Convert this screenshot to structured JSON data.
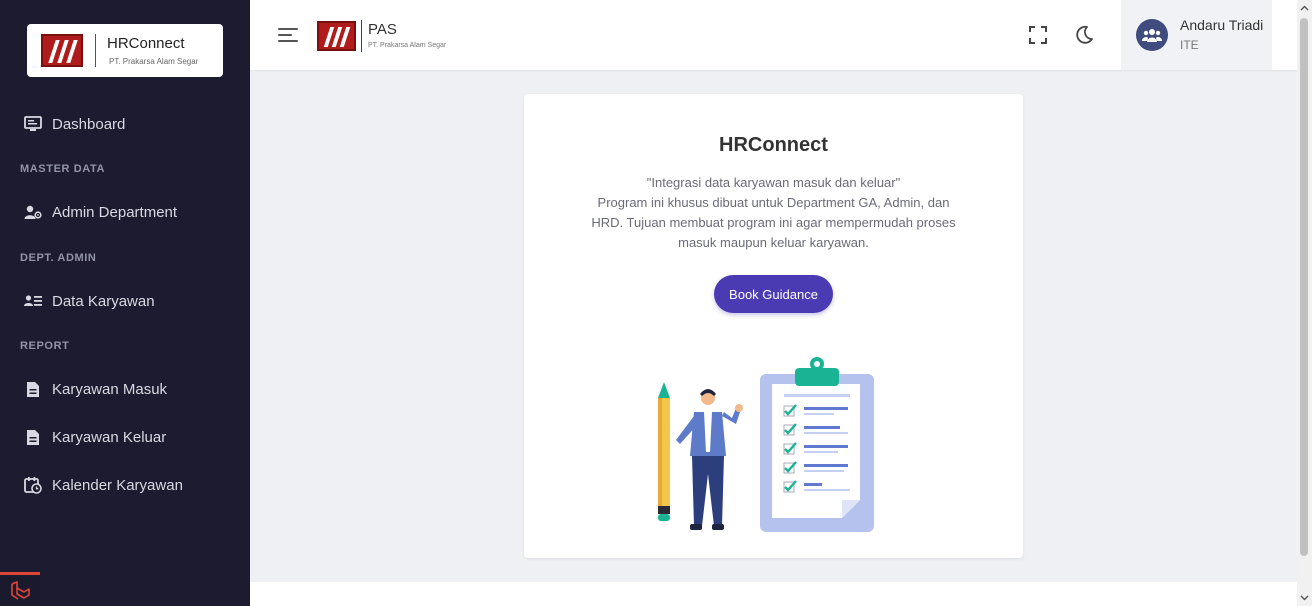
{
  "sidebar": {
    "brand_name": "HRConnect",
    "brand_sub": "PT. Prakarsa Alam Segar",
    "items": [
      {
        "label": "Dashboard"
      },
      {
        "section": "MASTER DATA"
      },
      {
        "label": "Admin Department"
      },
      {
        "section": "DEPT. ADMIN"
      },
      {
        "label": "Data Karyawan"
      },
      {
        "section": "REPORT"
      },
      {
        "label": "Karyawan Masuk"
      },
      {
        "label": "Karyawan Keluar"
      },
      {
        "label": "Kalender Karyawan"
      }
    ]
  },
  "header": {
    "logo_name": "PAS",
    "logo_sub": "PT. Prakarsa Alam Segar",
    "user": {
      "name": "Andaru Triadi",
      "role": "ITE"
    }
  },
  "card": {
    "title": "HRConnect",
    "quote": "\"Integrasi data karyawan masuk dan keluar\"",
    "description": "Program ini khusus dibuat untuk Department GA, Admin, dan HRD. Tujuan membuat program ini agar mempermudah proses masuk maupun keluar karyawan.",
    "button_label": "Book Guidance"
  },
  "colors": {
    "sidebar_bg": "#1c1b30",
    "accent": "#4b3bb2",
    "brand_red": "#b01c1c",
    "clipboard_teal": "#1ab394"
  }
}
